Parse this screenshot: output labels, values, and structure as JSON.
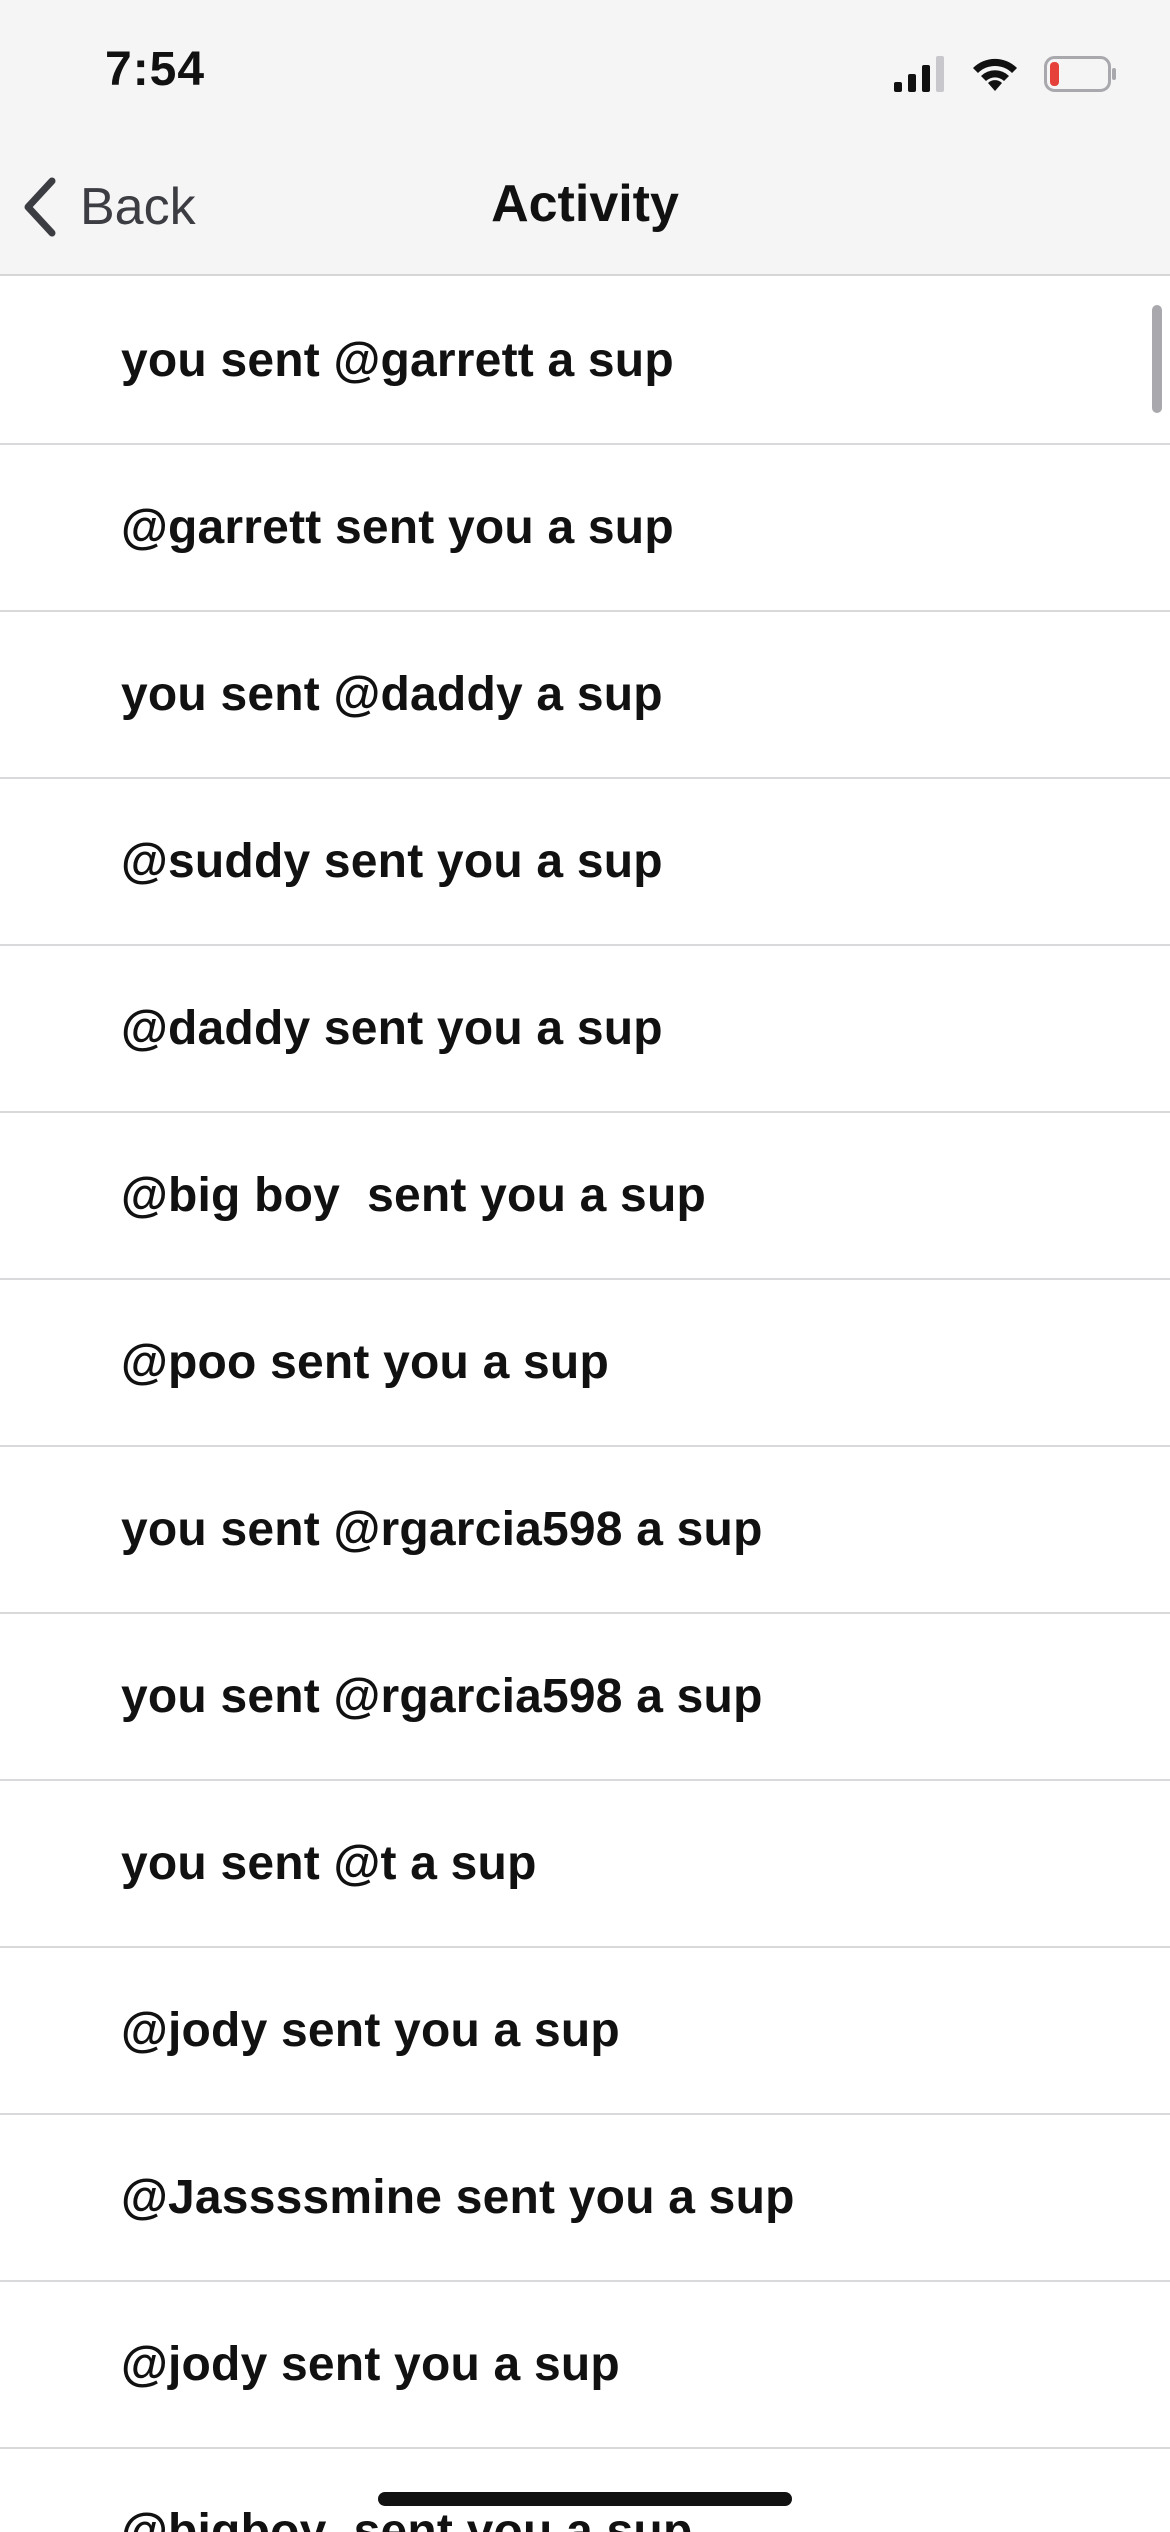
{
  "status_bar": {
    "time": "7:54",
    "icons": [
      "cellular-signal-icon",
      "wifi-icon",
      "battery-low-icon"
    ],
    "battery_color": "#e5413a"
  },
  "nav": {
    "back_label": "Back",
    "title": "Activity"
  },
  "activity": {
    "items": [
      "you sent @garrett a sup",
      "@garrett sent you a sup",
      "you sent @daddy a sup",
      "@suddy sent you a sup",
      "@daddy sent you a sup",
      "@big boy  sent you a sup",
      "@poo sent you a sup",
      "you sent @rgarcia598 a sup",
      "you sent @rgarcia598 a sup",
      "you sent @t a sup",
      "@jody sent you a sup",
      "@Jassssmine sent you a sup",
      "@jody sent you a sup",
      "@bigboy  sent you a sup"
    ]
  }
}
